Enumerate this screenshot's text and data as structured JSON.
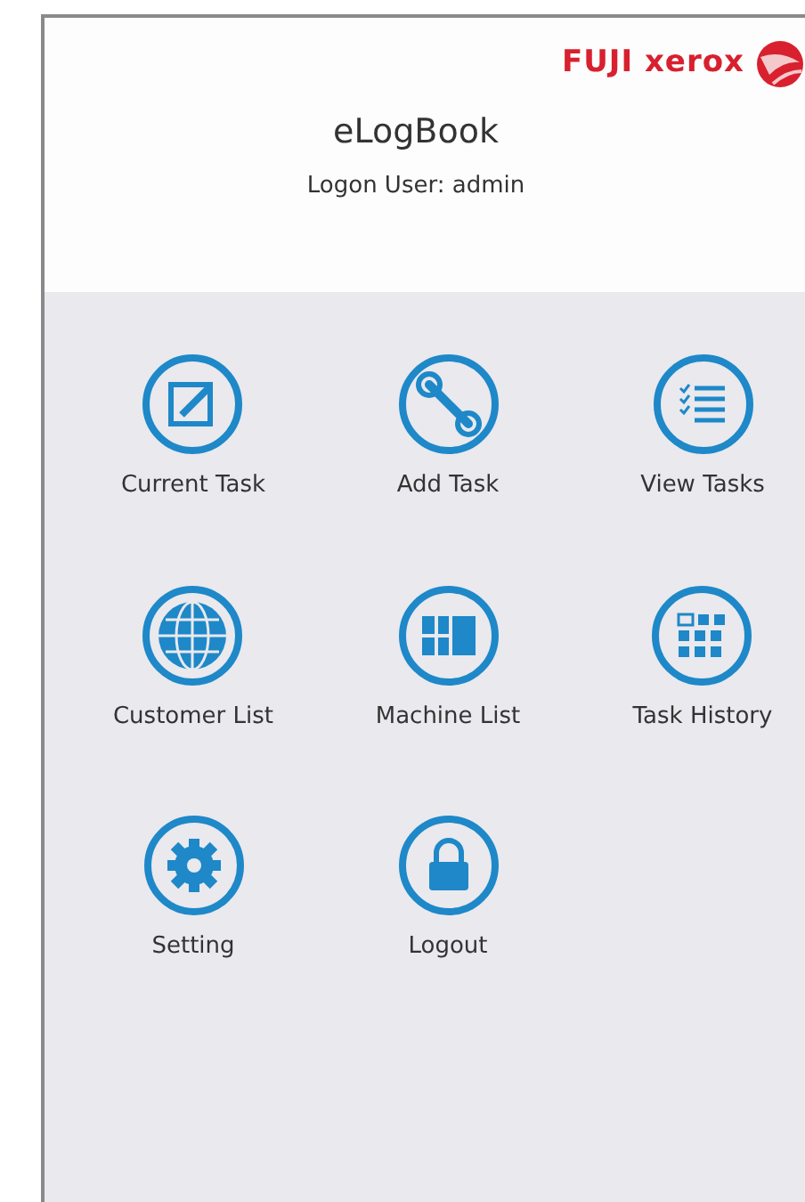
{
  "header": {
    "brand": "FUJI xerox",
    "title": "eLogBook",
    "user": "Logon User: admin"
  },
  "menu": [
    {
      "label": "Current Task",
      "kind": "edit"
    },
    {
      "label": "Add Task",
      "kind": "wrench"
    },
    {
      "label": "View Tasks",
      "kind": "list"
    },
    {
      "label": "Customer List",
      "kind": "globe"
    },
    {
      "label": "Machine List",
      "kind": "panels"
    },
    {
      "label": "Task History",
      "kind": "grid"
    },
    {
      "label": "Setting",
      "kind": "gear"
    },
    {
      "label": "Logout",
      "kind": "lock"
    }
  ]
}
